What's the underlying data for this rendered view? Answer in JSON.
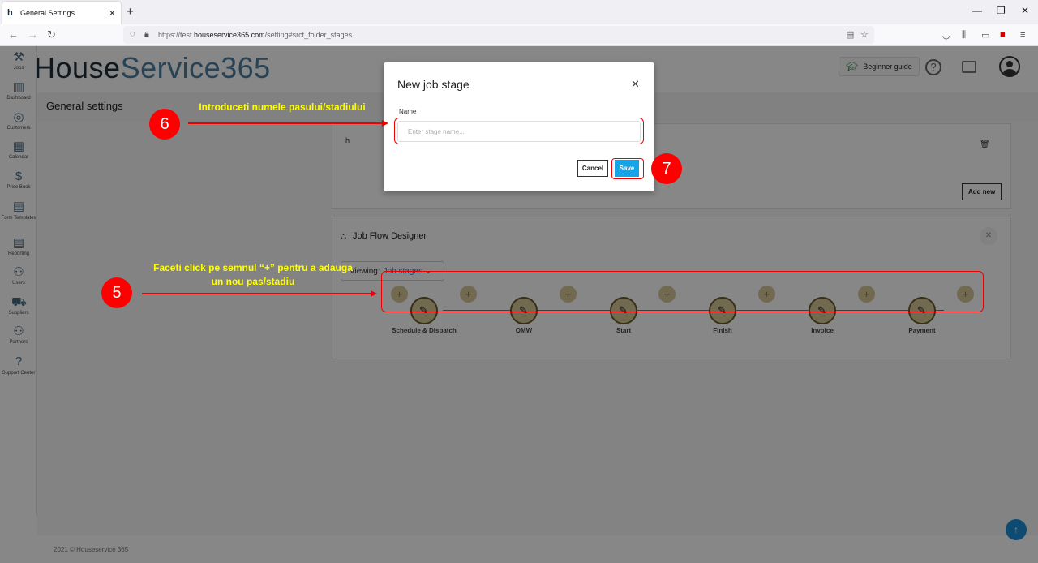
{
  "browser": {
    "tab_title": "General Settings",
    "tab_close": "✕",
    "new_tab": "+",
    "url_prefix": "https://test.",
    "url_domain": "houseservice365.com",
    "url_path": "/setting#srct_folder_stages",
    "window_controls": [
      "—",
      "❐",
      "✕"
    ]
  },
  "app": {
    "logo_letter": "h",
    "logo_part1": "House",
    "logo_part2": "Service365",
    "beginner_guide": "Beginner guide",
    "help_symbol": "?",
    "page_title": "General settings",
    "footer": "2021 © Houseservice 365",
    "scroll_top": "↑"
  },
  "sidebar": {
    "items": [
      {
        "label": "Jobs",
        "icon": "tools-icon",
        "glyph": "⚒"
      },
      {
        "label": "Dashboard",
        "icon": "chart-icon",
        "glyph": "▥"
      },
      {
        "label": "Customers",
        "icon": "customers-icon",
        "glyph": "◎"
      },
      {
        "label": "Calendar",
        "icon": "calendar-icon",
        "glyph": "▦"
      },
      {
        "label": "Price Book",
        "icon": "pricebook-icon",
        "glyph": "$"
      },
      {
        "label": "Form Templates",
        "icon": "form-icon",
        "glyph": "▤"
      },
      {
        "label": "Reporting",
        "icon": "report-icon",
        "glyph": "▤"
      },
      {
        "label": "Users",
        "icon": "users-icon",
        "glyph": "⚇"
      },
      {
        "label": "Suppliers",
        "icon": "truck-icon",
        "glyph": "⛟"
      },
      {
        "label": "Partners",
        "icon": "partners-icon",
        "glyph": "⚇"
      },
      {
        "label": "Support Center",
        "icon": "support-icon",
        "glyph": "?"
      }
    ]
  },
  "stages_card": {
    "item_label": "h",
    "add_new": "Add new"
  },
  "job_flow": {
    "title": "Job Flow Designer",
    "viewing_label": "Viewing:",
    "viewing_value": "Job stages",
    "stages": [
      "Schedule & Dispatch",
      "OMW",
      "Start",
      "Finish",
      "Invoice",
      "Payment"
    ]
  },
  "modal": {
    "title": "New job stage",
    "close": "✕",
    "name_label": "Name",
    "name_value": "",
    "name_placeholder": "Enter stage name...",
    "cancel": "Cancel",
    "save": "Save"
  },
  "annotations": {
    "badge5": "5",
    "badge6": "6",
    "badge7": "7",
    "note6": "Introduceti numele pasului/stadiului",
    "note5_line1": "Faceti click pe semnul “+” pentru a adauga",
    "note5_line2": "un nou pas/stadiu"
  },
  "colors": {
    "accent": "#16a3e8",
    "annotation_red": "#ff0000",
    "annotation_text": "#ffff00",
    "stage_fill": "#d8c79a"
  }
}
